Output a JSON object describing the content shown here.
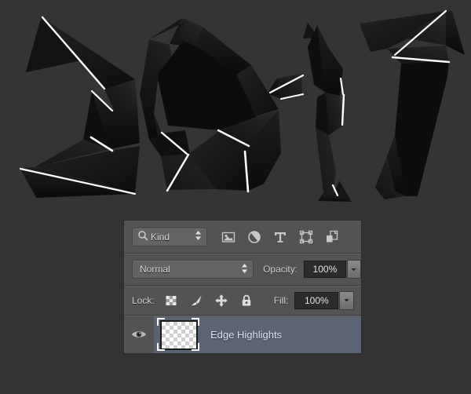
{
  "artwork": {
    "name": "origami-2017-artwork",
    "description": "Dark low-poly origami folded paper forming the digits 2017 with thin white edge highlights",
    "text_depicted": "2017",
    "background_color": "#343434",
    "paper_dark": "#121212",
    "paper_mid": "#1c1c1c",
    "paper_light": "#262626",
    "highlight_color": "#ffffff"
  },
  "layers_panel": {
    "background_color": "#535353",
    "filter_row": {
      "kind_dropdown": {
        "label": "Kind",
        "icon": "search-icon"
      },
      "filter_icons": [
        {
          "name": "pixel-layers-filter-icon",
          "tooltip": "Pixel Layers"
        },
        {
          "name": "adjustment-layers-filter-icon",
          "tooltip": "Adjustment Layers"
        },
        {
          "name": "type-layers-filter-icon",
          "tooltip": "Type Layers",
          "glyph": "T"
        },
        {
          "name": "shape-layers-filter-icon",
          "tooltip": "Shape Layers"
        },
        {
          "name": "smart-object-filter-icon",
          "tooltip": "Smart Objects"
        }
      ]
    },
    "blend_row": {
      "blend_mode": "Normal",
      "opacity_label": "Opacity:",
      "opacity_value": "100%"
    },
    "lock_row": {
      "lock_label": "Lock:",
      "lock_icons": [
        {
          "name": "lock-transparent-pixels-icon",
          "tooltip": "Lock transparent pixels"
        },
        {
          "name": "lock-image-pixels-icon",
          "tooltip": "Lock image pixels"
        },
        {
          "name": "lock-position-icon",
          "tooltip": "Lock position"
        },
        {
          "name": "lock-all-icon",
          "tooltip": "Lock all"
        }
      ],
      "fill_label": "Fill:",
      "fill_value": "100%"
    },
    "layers": [
      {
        "name": "Edge Highlights",
        "visible": true,
        "selected": true,
        "thumbnail": "transparent-checkerboard",
        "selected_color": "#5a6473"
      }
    ]
  }
}
